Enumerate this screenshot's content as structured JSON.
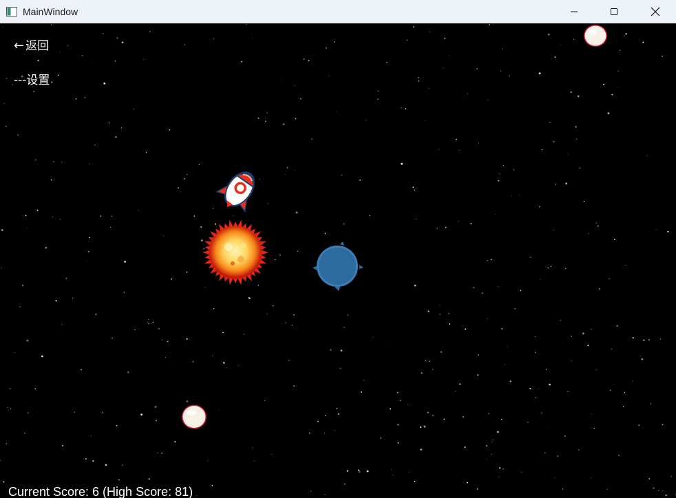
{
  "window": {
    "title": "MainWindow",
    "controls": [
      "minimize",
      "maximize",
      "close"
    ]
  },
  "menu": {
    "back_arrow": "←",
    "back_label": "返回",
    "settings_label": "---设置"
  },
  "score": {
    "text": "Current Score: 6 (High Score: 81)",
    "current": 6,
    "high": 81
  },
  "sprites": {
    "player": "rocket-ship-icon",
    "hazard": "fireball-icon",
    "planet": "blue-planet-icon",
    "pickups": [
      "white-orb-icon",
      "white-orb-icon"
    ]
  },
  "colors": {
    "background": "#000000",
    "titlebar": "#eef2f9",
    "text": "#ffffff",
    "rocket_red": "#e8301c",
    "planet_blue": "#2e6fa3",
    "fireball": "#f7a21b"
  }
}
